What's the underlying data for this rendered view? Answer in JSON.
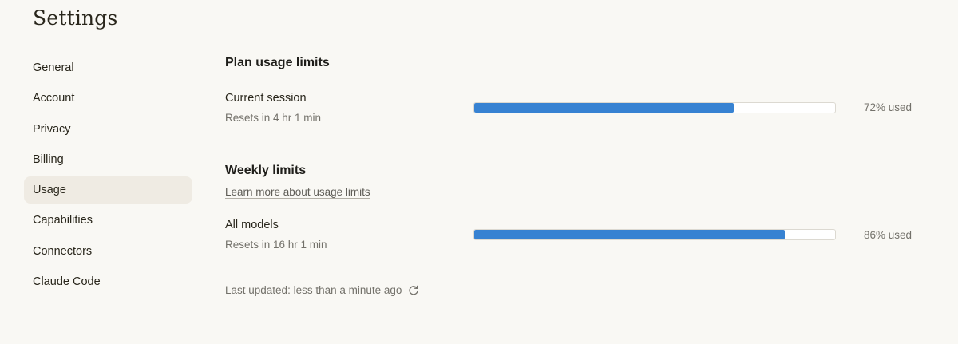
{
  "page": {
    "title": "Settings"
  },
  "sidebar": {
    "items": [
      {
        "label": "General"
      },
      {
        "label": "Account"
      },
      {
        "label": "Privacy"
      },
      {
        "label": "Billing"
      },
      {
        "label": "Usage",
        "active": true
      },
      {
        "label": "Capabilities"
      },
      {
        "label": "Connectors"
      },
      {
        "label": "Claude Code"
      }
    ]
  },
  "plan_usage": {
    "title": "Plan usage limits",
    "current_session": {
      "label": "Current session",
      "reset": "Resets in 4 hr 1 min",
      "percent": 72,
      "percent_text": "72% used"
    }
  },
  "weekly": {
    "title": "Weekly limits",
    "learn_more": "Learn more about usage limits",
    "all_models": {
      "label": "All models",
      "reset": "Resets in 16 hr 1 min",
      "percent": 86,
      "percent_text": "86% used"
    }
  },
  "status": {
    "last_updated": "Last updated: less than a minute ago",
    "refresh_icon": "refresh-icon"
  },
  "colors": {
    "accent": "#3782d2",
    "background": "#f9f8f4",
    "active_item": "#efebe3"
  }
}
